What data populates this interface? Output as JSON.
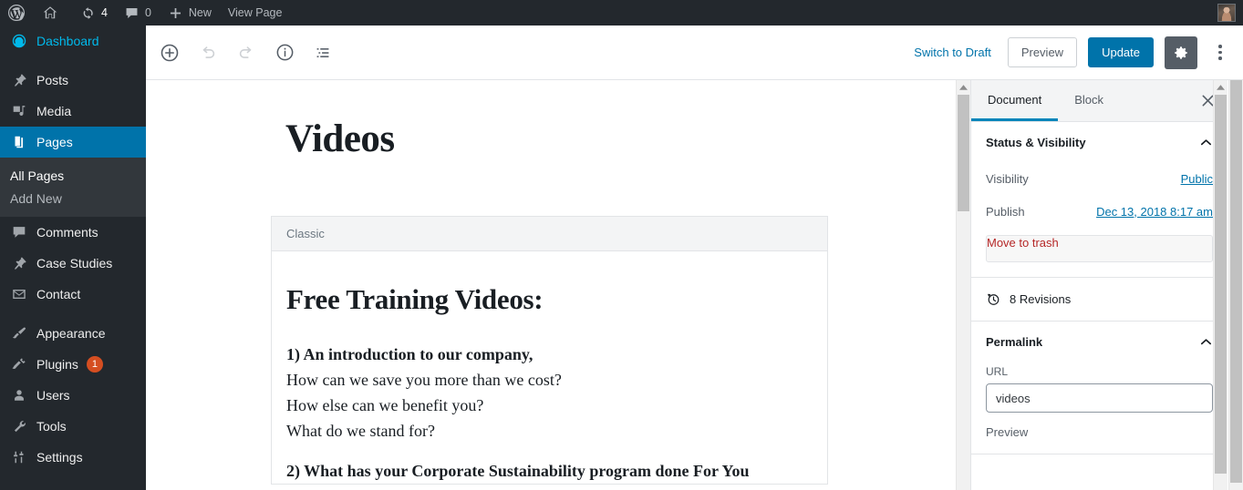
{
  "adminbar": {
    "logo_icon": "wordpress-logo-icon",
    "home_icon": "home-icon",
    "updates_icon": "updates-icon",
    "updates_count": "4",
    "comments_icon": "comment-bubble-icon",
    "comments_count": "0",
    "new_icon": "plus-icon",
    "new_label": "New",
    "view_page_label": "View Page",
    "avatar_name": "account-avatar"
  },
  "sidebar_menu": {
    "items": [
      {
        "label": "Dashboard",
        "icon": "dashboard-icon",
        "state": "link-highlight"
      },
      {
        "label": "Posts",
        "icon": "pin-icon",
        "state": "normal"
      },
      {
        "label": "Media",
        "icon": "media-icon",
        "state": "normal"
      },
      {
        "label": "Pages",
        "icon": "pages-icon",
        "state": "current"
      },
      {
        "label": "Comments",
        "icon": "comment-bubble-icon",
        "state": "normal"
      },
      {
        "label": "Case Studies",
        "icon": "pin-icon",
        "state": "normal"
      },
      {
        "label": "Contact",
        "icon": "envelope-icon",
        "state": "normal"
      },
      {
        "label": "Appearance",
        "icon": "brush-icon",
        "state": "normal"
      },
      {
        "label": "Plugins",
        "icon": "plug-icon",
        "state": "normal",
        "badge": "1"
      },
      {
        "label": "Users",
        "icon": "user-icon",
        "state": "normal"
      },
      {
        "label": "Tools",
        "icon": "wrench-icon",
        "state": "normal"
      },
      {
        "label": "Settings",
        "icon": "sliders-icon",
        "state": "normal"
      }
    ],
    "submenu": [
      {
        "label": "All Pages",
        "state": "current"
      },
      {
        "label": "Add New",
        "state": "normal"
      }
    ]
  },
  "editor_header": {
    "add_block_icon": "add-block-plus-circle-icon",
    "undo_icon": "undo-arrow-icon",
    "redo_icon": "redo-arrow-icon",
    "info_icon": "info-circle-icon",
    "block_nav_icon": "block-navigation-list-icon",
    "switch_to_draft_label": "Switch to Draft",
    "preview_label": "Preview",
    "update_label": "Update",
    "settings_icon": "gear-icon",
    "more_menu_icon": "kebab-menu-icon"
  },
  "document": {
    "title": "Videos",
    "block_label": "Classic",
    "content": {
      "heading": "Free Training Videos:",
      "paragraphs": [
        {
          "text": "1) An introduction to our company,",
          "bold": true
        },
        {
          "text": "How can we save you more than we cost?",
          "bold": false
        },
        {
          "text": "How else can we benefit you?",
          "bold": false
        },
        {
          "text": "What do we stand for?",
          "bold": false
        },
        {
          "text": "2) What has your Corporate Sustainability program done For You",
          "bold": true
        }
      ]
    }
  },
  "settings_sidebar": {
    "tabs": [
      {
        "label": "Document",
        "active": true
      },
      {
        "label": "Block",
        "active": false
      }
    ],
    "close_icon": "close-icon",
    "status_panel": {
      "title": "Status & Visibility",
      "collapse_icon": "chevron-up-icon",
      "visibility_label": "Visibility",
      "visibility_value": "Public",
      "publish_label": "Publish",
      "publish_value": "Dec 13, 2018 8:17 am",
      "trash_label": "Move to trash"
    },
    "revisions": {
      "icon": "revisions-clock-icon",
      "label": "8 Revisions"
    },
    "permalink_panel": {
      "title": "Permalink",
      "collapse_icon": "chevron-up-icon",
      "url_label": "URL",
      "url_value": "videos",
      "preview_label": "Preview"
    }
  },
  "colors": {
    "accent_blue": "#0073aa",
    "admin_dark": "#23282d",
    "submenu_dark": "#32373c",
    "badge_orange": "#d54e21",
    "danger_red": "#b52727",
    "tab_active": "#0085ba"
  }
}
